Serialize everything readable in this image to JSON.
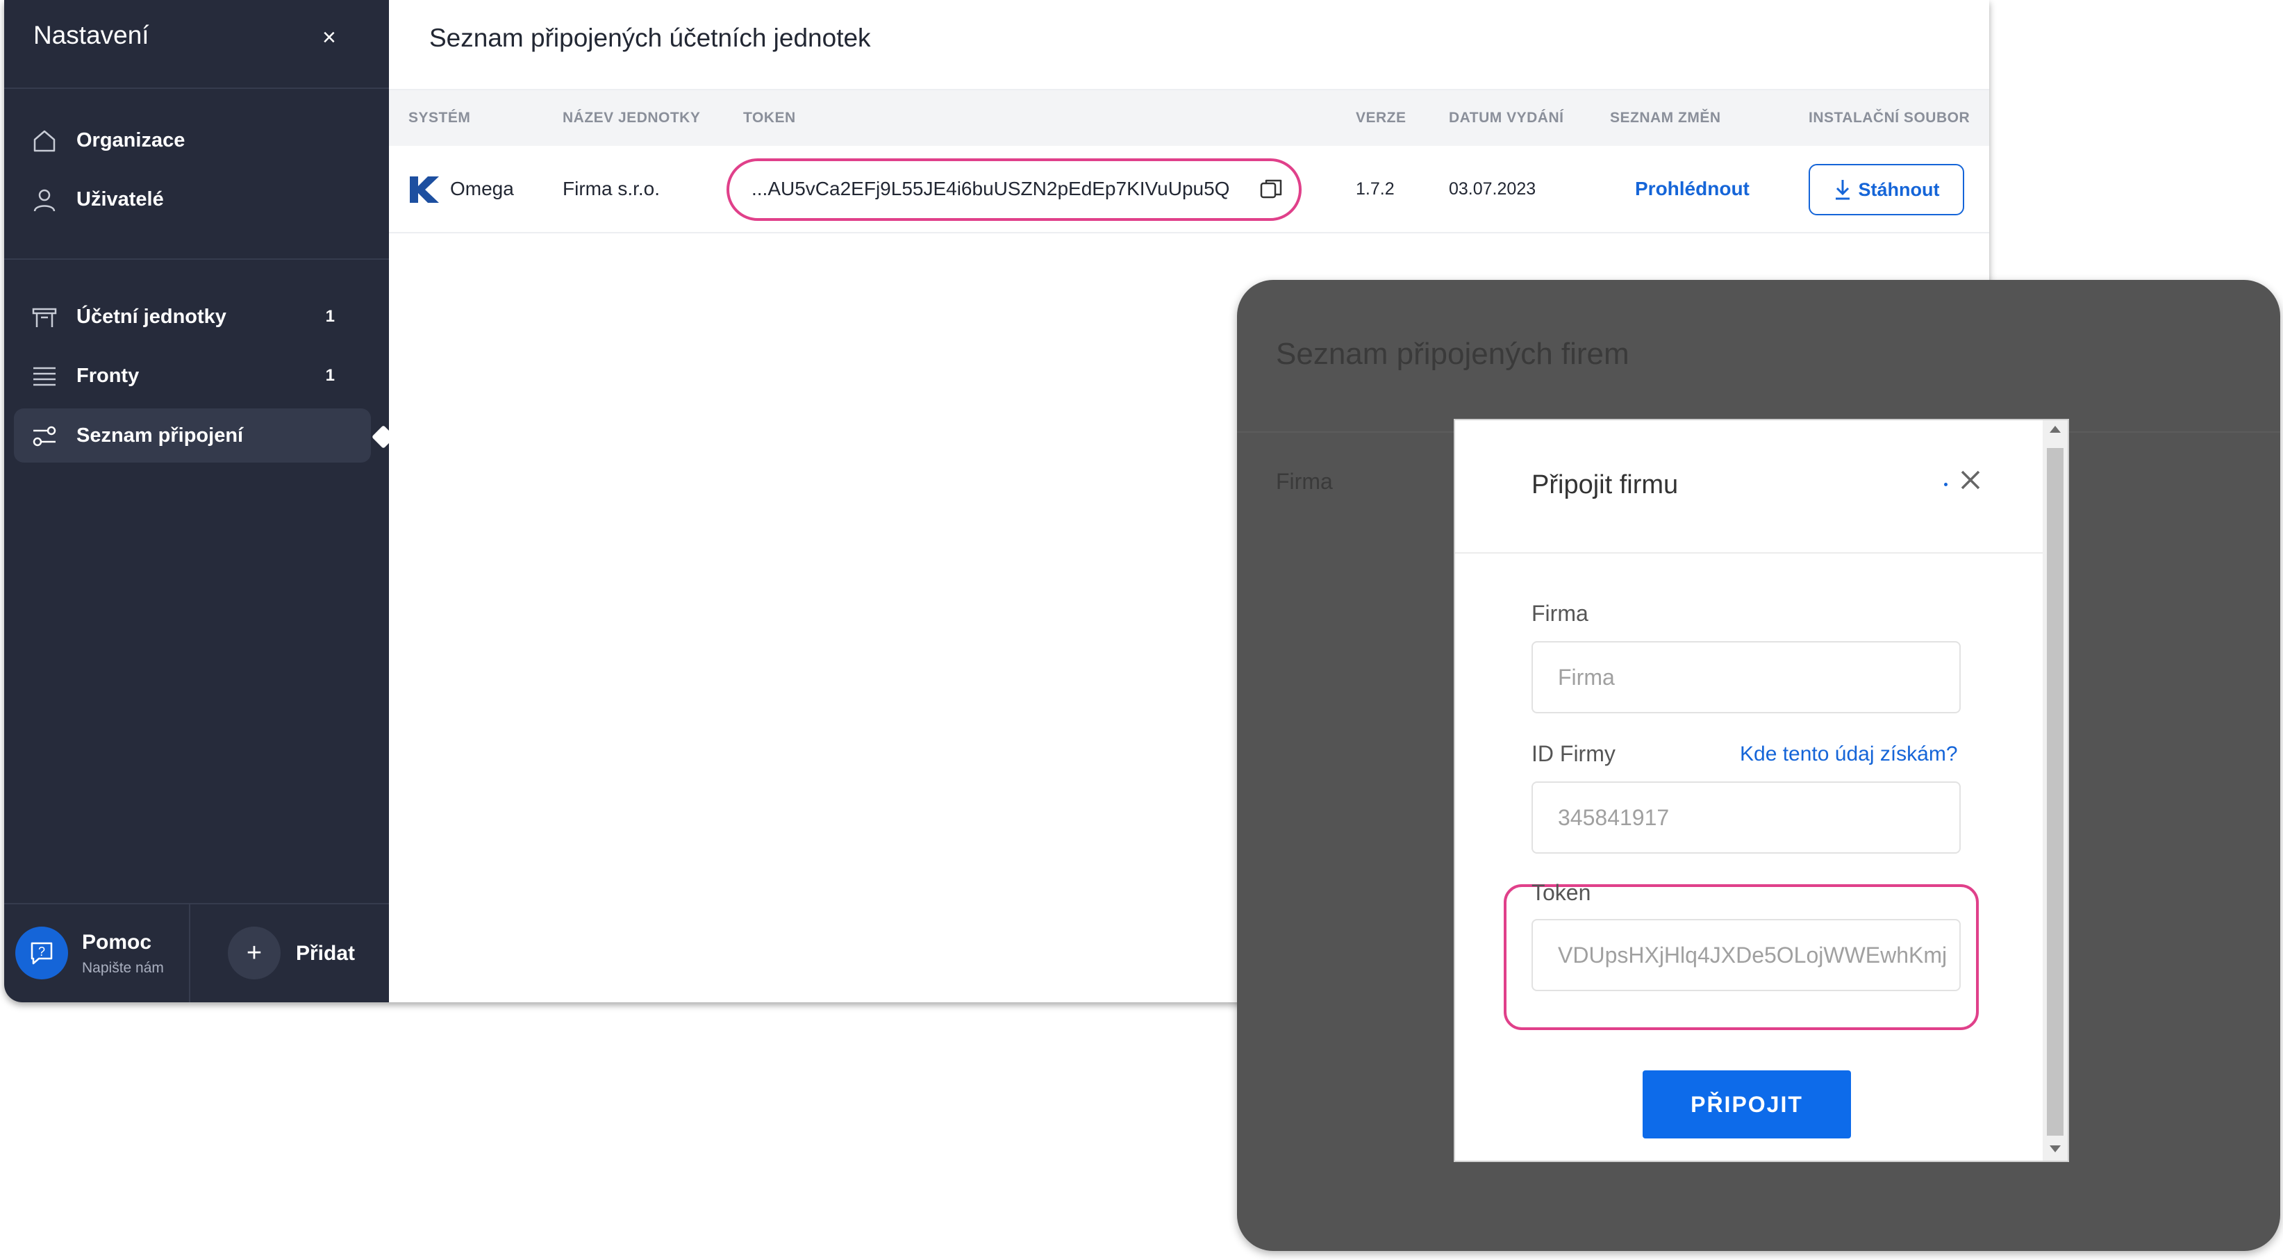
{
  "sidebar": {
    "title": "Nastavení",
    "close_label": "×",
    "items": [
      {
        "label": "Organizace",
        "icon": "home-icon"
      },
      {
        "label": "Uživatelé",
        "icon": "user-icon"
      },
      {
        "label": "Účetní jednotky",
        "icon": "bench-icon",
        "count": "1"
      },
      {
        "label": "Fronty",
        "icon": "list-icon",
        "count": "1"
      },
      {
        "label": "Seznam připojení",
        "icon": "connections-icon",
        "active": true
      }
    ],
    "help": {
      "title": "Pomoc",
      "subtitle": "Napište nám"
    },
    "add": {
      "symbol": "+",
      "label": "Přidat"
    }
  },
  "main": {
    "title": "Seznam připojených účetních jednotek",
    "columns": [
      "SYSTÉM",
      "NÁZEV JEDNOTKY",
      "TOKEN",
      "VERZE",
      "DATUM VYDÁNÍ",
      "SEZNAM ZMĚN",
      "INSTALAČNÍ SOUBOR"
    ],
    "rows": [
      {
        "system": "Omega",
        "name": "Firma s.r.o.",
        "token": "...AU5vCa2EFj9L55JE4i6buUSZN2pEdEp7KIVuUpu5Q",
        "version": "1.7.2",
        "date": "03.07.2023",
        "changes": "Prohlédnout",
        "download": "Stáhnout"
      }
    ]
  },
  "panel": {
    "title": "Seznam připojených firem",
    "column_label": "Firma"
  },
  "modal": {
    "title": "Připojit firmu",
    "firma": {
      "label": "Firma",
      "placeholder": "Firma"
    },
    "id_firmy": {
      "label": "ID Firmy",
      "help": "Kde tento údaj získám?",
      "value": "345841917"
    },
    "token": {
      "label": "Token",
      "value": "VDUpsHXjHlq4JXDe5OLojWWEwhKmj"
    },
    "connect_button": "PŘIPOJIT"
  },
  "colors": {
    "sidebar_bg": "#262b3b",
    "accent": "#1565d8",
    "highlight": "#e0408a",
    "panel_bg": "#545454"
  }
}
